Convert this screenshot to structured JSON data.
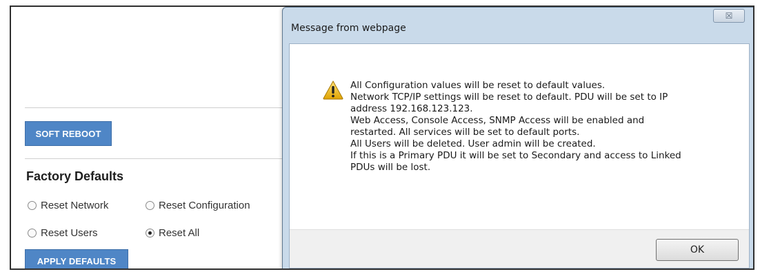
{
  "app": {
    "soft_reboot_label": "SOFT REBOOT",
    "factory_defaults_title": "Factory Defaults",
    "options": [
      {
        "label": "Reset Network",
        "checked": false
      },
      {
        "label": "Reset Configuration",
        "checked": false
      },
      {
        "label": "Reset Users",
        "checked": false
      },
      {
        "label": "Reset All",
        "checked": true
      }
    ],
    "apply_defaults_label": "APPLY DEFAULTS",
    "button_color": "#4f86c6"
  },
  "dialog": {
    "title": "Message from webpage",
    "close_glyph": "☒",
    "icon": "warning-icon",
    "lines": [
      "All Configuration values will be reset to default values.",
      "Network TCP/IP settings will be reset to default.  PDU will be set to IP",
      "address 192.168.123.123.",
      "Web Access, Console Access, SNMP Access will be enabled and",
      "restarted.  All services will be set to default ports.",
      "All Users will be deleted.  User admin will be created.",
      "If this is a Primary PDU it will be set to Secondary and access to Linked",
      "PDUs will be lost."
    ],
    "ok_label": "OK"
  }
}
